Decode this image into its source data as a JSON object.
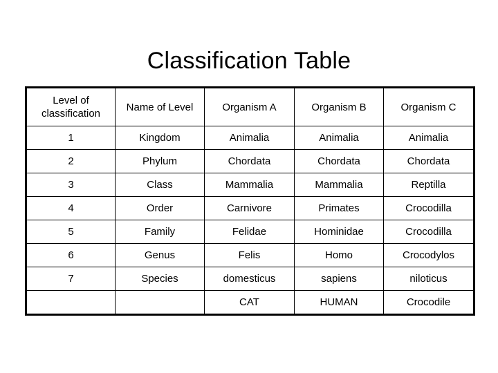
{
  "page": {
    "title": "Classification Table",
    "background_color": "#ffffff",
    "text_color": "#000000",
    "border_color": "#000000"
  },
  "table": {
    "headers": [
      "Level of classification",
      "Name of Level",
      "Organism A",
      "Organism B",
      "Organism C"
    ],
    "rows": [
      [
        "1",
        "Kingdom",
        "Animalia",
        "Animalia",
        "Animalia"
      ],
      [
        "2",
        "Phylum",
        "Chordata",
        "Chordata",
        "Chordata"
      ],
      [
        "3",
        "Class",
        "Mammalia",
        "Mammalia",
        "Reptilla"
      ],
      [
        "4",
        "Order",
        "Carnivore",
        "Primates",
        "Crocodilla"
      ],
      [
        "5",
        "Family",
        "Felidae",
        "Hominidae",
        "Crocodilla"
      ],
      [
        "6",
        "Genus",
        "Felis",
        "Homo",
        "Crocodylos"
      ],
      [
        "7",
        "Species",
        "domesticus",
        "sapiens",
        "niloticus"
      ],
      [
        "",
        "",
        "CAT",
        "HUMAN",
        "Crocodile"
      ]
    ]
  }
}
